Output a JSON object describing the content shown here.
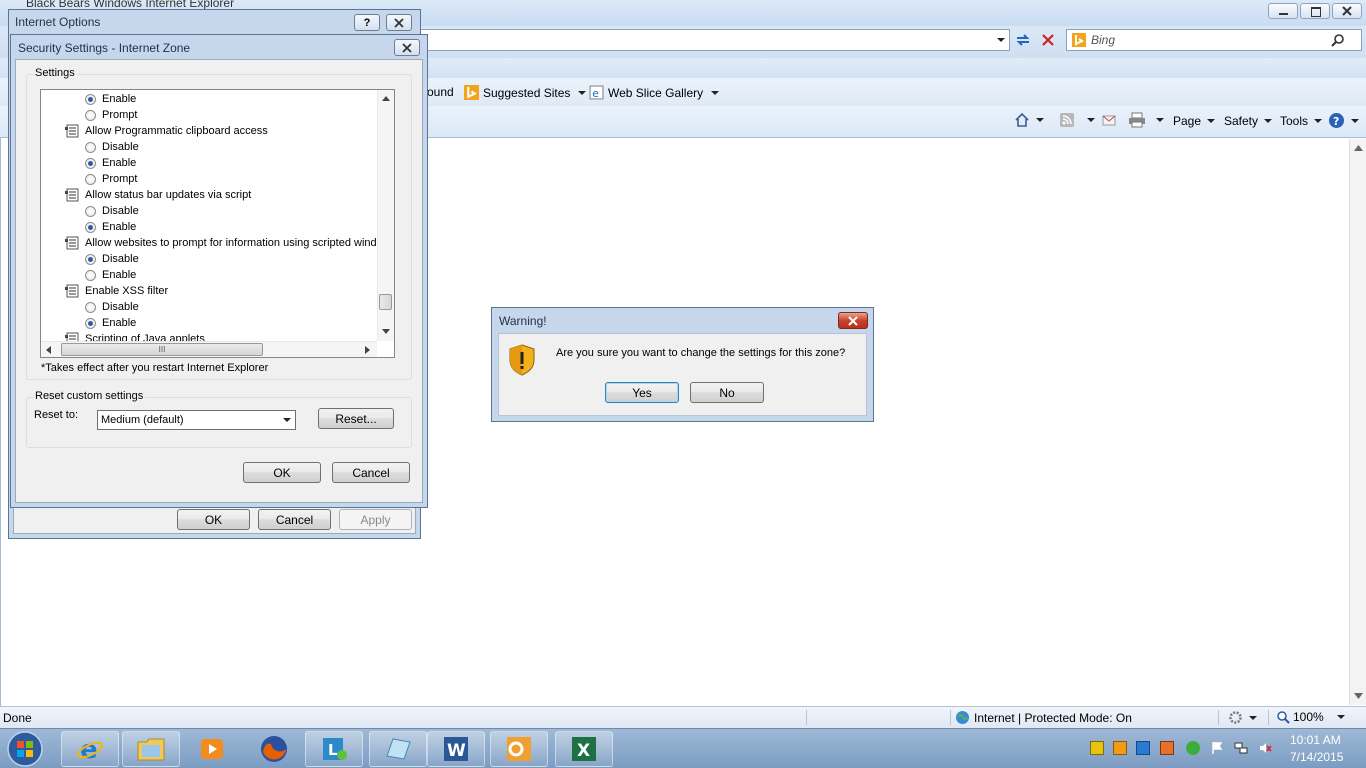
{
  "browser": {
    "window_title": "Black Bears Windows Internet Explorer",
    "search_placeholder": "Bing",
    "favorites": {
      "partial_item": "ound",
      "suggested_sites": "Suggested Sites",
      "web_slice_gallery": "Web Slice Gallery"
    },
    "command_bar": {
      "page": "Page",
      "safety": "Safety",
      "tools": "Tools"
    },
    "status": {
      "text": "Done",
      "zone": "Internet | Protected Mode: On",
      "zoom": "100%"
    }
  },
  "internet_options": {
    "title": "Internet Options",
    "ok": "OK",
    "cancel": "Cancel",
    "apply": "Apply"
  },
  "security_settings": {
    "title": "Security Settings - Internet Zone",
    "group_label": "Settings",
    "rows": [
      {
        "kind": "option",
        "label": "Enable",
        "selected": true
      },
      {
        "kind": "option",
        "label": "Prompt",
        "selected": false
      },
      {
        "kind": "heading",
        "label": "Allow Programmatic clipboard access"
      },
      {
        "kind": "option",
        "label": "Disable",
        "selected": false
      },
      {
        "kind": "option",
        "label": "Enable",
        "selected": true
      },
      {
        "kind": "option",
        "label": "Prompt",
        "selected": false
      },
      {
        "kind": "heading",
        "label": "Allow status bar updates via script"
      },
      {
        "kind": "option",
        "label": "Disable",
        "selected": false
      },
      {
        "kind": "option",
        "label": "Enable",
        "selected": true
      },
      {
        "kind": "heading",
        "label": "Allow websites to prompt for information using scripted windows"
      },
      {
        "kind": "option",
        "label": "Disable",
        "selected": true
      },
      {
        "kind": "option",
        "label": "Enable",
        "selected": false
      },
      {
        "kind": "heading",
        "label": "Enable XSS filter"
      },
      {
        "kind": "option",
        "label": "Disable",
        "selected": false
      },
      {
        "kind": "option",
        "label": "Enable",
        "selected": true
      },
      {
        "kind": "heading",
        "label": "Scripting of Java applets"
      }
    ],
    "hscroll_grip": "III",
    "restart_note": "*Takes effect after you restart Internet Explorer",
    "reset_group_label": "Reset custom settings",
    "reset_to_label": "Reset to:",
    "reset_to_value": "Medium (default)",
    "reset_button": "Reset...",
    "ok": "OK",
    "cancel": "Cancel"
  },
  "warning": {
    "title": "Warning!",
    "message": "Are you sure you want to change the settings for this zone?",
    "yes": "Yes",
    "no": "No"
  },
  "taskbar": {
    "pinned": [
      "Internet Explorer",
      "Windows Explorer",
      "Media Player",
      "Firefox",
      "Lync",
      "Notepad",
      "Word",
      "Outlook",
      "Excel"
    ],
    "clock_time": "10:01 AM",
    "clock_date": "7/14/2015"
  }
}
